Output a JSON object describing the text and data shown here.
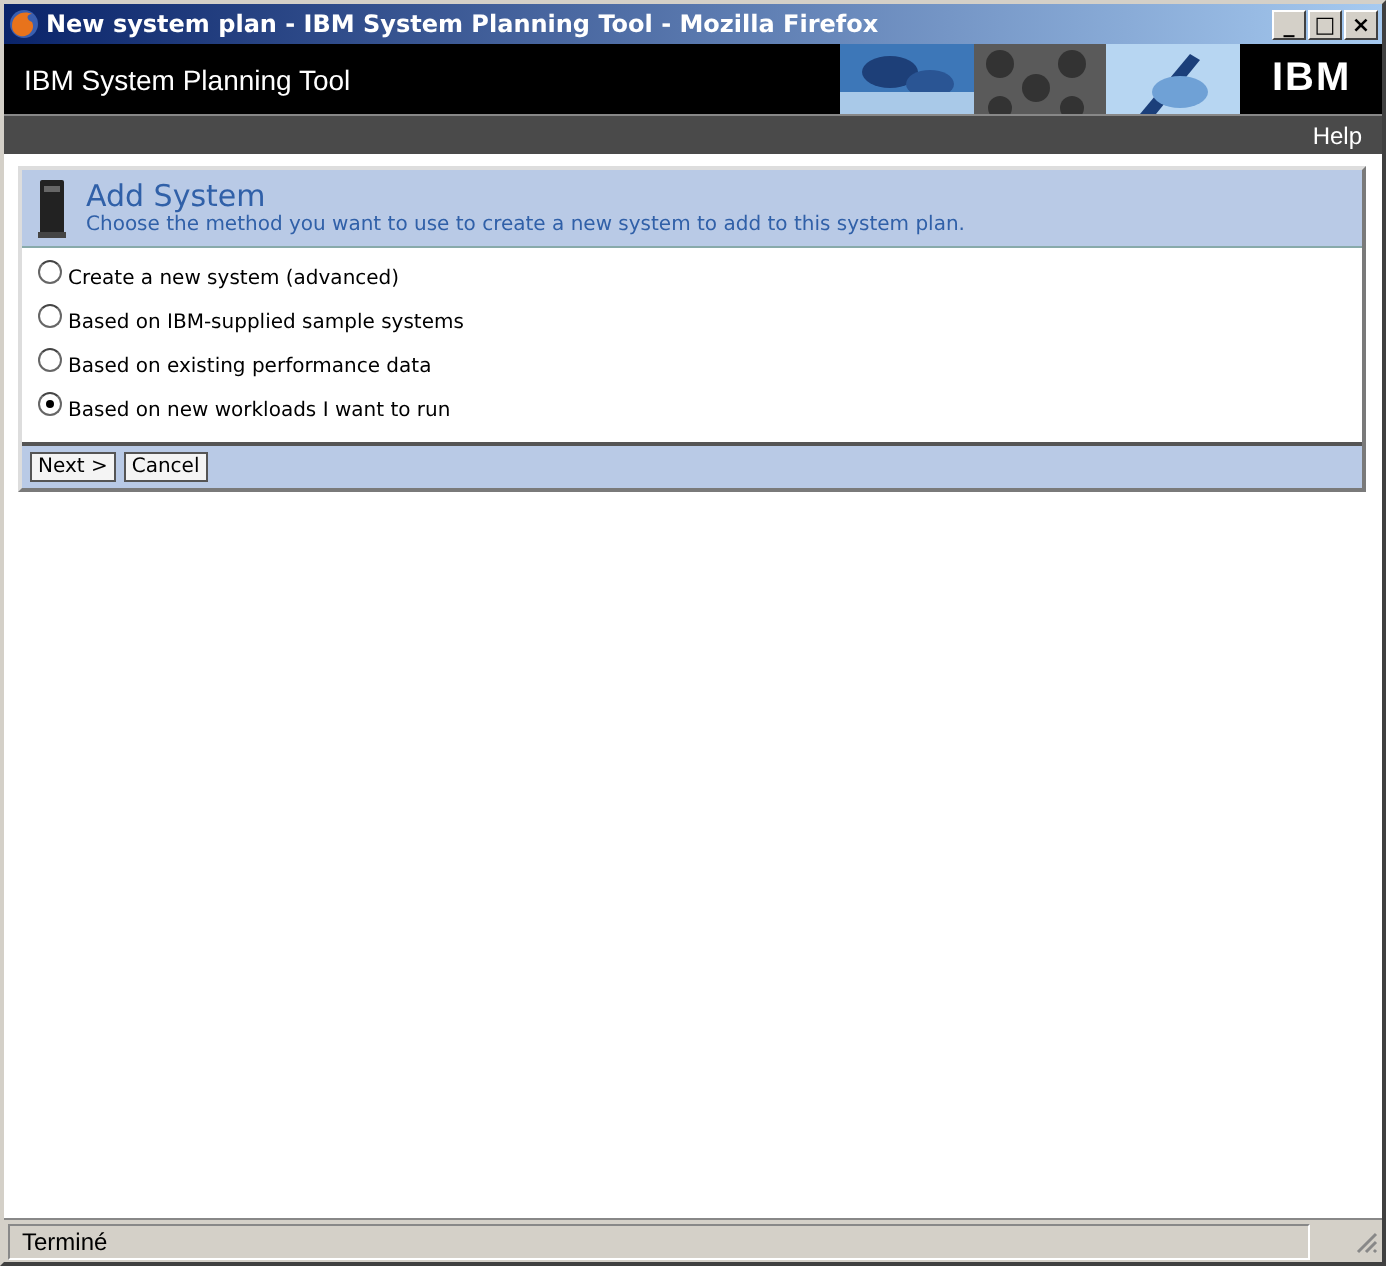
{
  "window": {
    "title": "New system plan - IBM System Planning Tool - Mozilla Firefox",
    "controls": [
      "_",
      "□",
      "×"
    ]
  },
  "header": {
    "title": "IBM System Planning Tool",
    "logo": "IBM"
  },
  "nav": {
    "items": [
      "Help"
    ]
  },
  "panel": {
    "title": "Add System",
    "subtitle": "Choose the method you want to use to create a new system to add to this system plan.",
    "options": [
      {
        "label": "Create a new system (advanced)",
        "selected": false
      },
      {
        "label": "Based on IBM-supplied sample systems",
        "selected": false
      },
      {
        "label": "Based on existing performance data",
        "selected": false
      },
      {
        "label": "Based on new workloads I want to run",
        "selected": true
      }
    ],
    "buttons": [
      "Next >",
      "Cancel"
    ]
  },
  "status_bar": {
    "text": "Terminé"
  }
}
